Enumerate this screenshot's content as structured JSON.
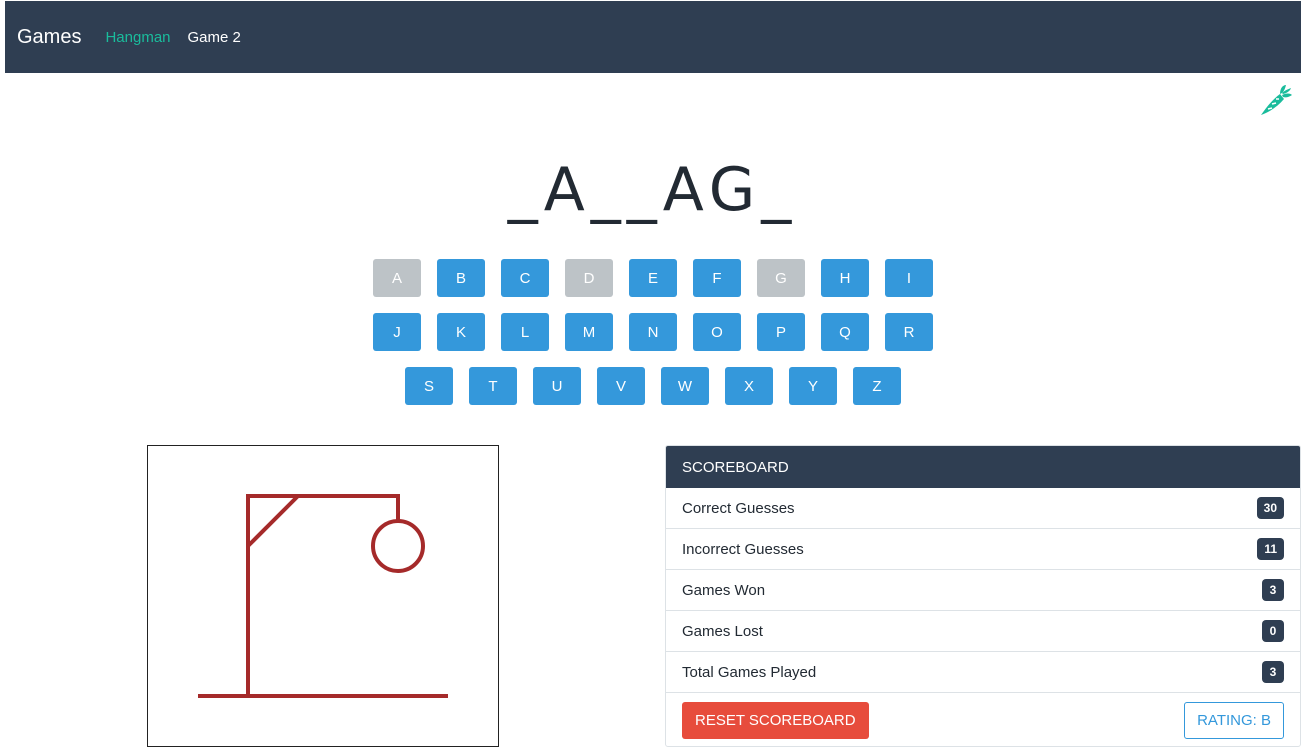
{
  "navbar": {
    "brand": "Games",
    "links": [
      {
        "label": "Hangman",
        "active": true
      },
      {
        "label": "Game 2",
        "active": false
      }
    ]
  },
  "logo_icon": "carrot-icon",
  "puzzle": {
    "display": "_A__AG_"
  },
  "keyboard": {
    "rows": [
      [
        {
          "letter": "A",
          "used": true
        },
        {
          "letter": "B",
          "used": false
        },
        {
          "letter": "C",
          "used": false
        },
        {
          "letter": "D",
          "used": true
        },
        {
          "letter": "E",
          "used": false
        },
        {
          "letter": "F",
          "used": false
        },
        {
          "letter": "G",
          "used": true
        },
        {
          "letter": "H",
          "used": false
        },
        {
          "letter": "I",
          "used": false
        }
      ],
      [
        {
          "letter": "J",
          "used": false
        },
        {
          "letter": "K",
          "used": false
        },
        {
          "letter": "L",
          "used": false
        },
        {
          "letter": "M",
          "used": false
        },
        {
          "letter": "N",
          "used": false
        },
        {
          "letter": "O",
          "used": false
        },
        {
          "letter": "P",
          "used": false
        },
        {
          "letter": "Q",
          "used": false
        },
        {
          "letter": "R",
          "used": false
        }
      ],
      [
        {
          "letter": "S",
          "used": false
        },
        {
          "letter": "T",
          "used": false
        },
        {
          "letter": "U",
          "used": false
        },
        {
          "letter": "V",
          "used": false
        },
        {
          "letter": "W",
          "used": false
        },
        {
          "letter": "X",
          "used": false
        },
        {
          "letter": "Y",
          "used": false
        },
        {
          "letter": "Z",
          "used": false
        }
      ]
    ]
  },
  "gallows": {
    "stage_parts_drawn": [
      "base",
      "pole",
      "beam",
      "brace",
      "rope",
      "head"
    ],
    "stroke_color": "#a52a2a"
  },
  "scoreboard": {
    "title": "SCOREBOARD",
    "rows": [
      {
        "label": "Correct Guesses",
        "value": "30"
      },
      {
        "label": "Incorrect Guesses",
        "value": "11"
      },
      {
        "label": "Games Won",
        "value": "3"
      },
      {
        "label": "Games Lost",
        "value": "0"
      },
      {
        "label": "Total Games Played",
        "value": "3"
      }
    ],
    "reset_label": "RESET SCOREBOARD",
    "rating_label": "RATING: B"
  },
  "colors": {
    "navbar": "#2f3e52",
    "accent": "#1abc9c",
    "key": "#3498db",
    "key_used": "#bdc3c7",
    "danger": "#e74c3c"
  }
}
